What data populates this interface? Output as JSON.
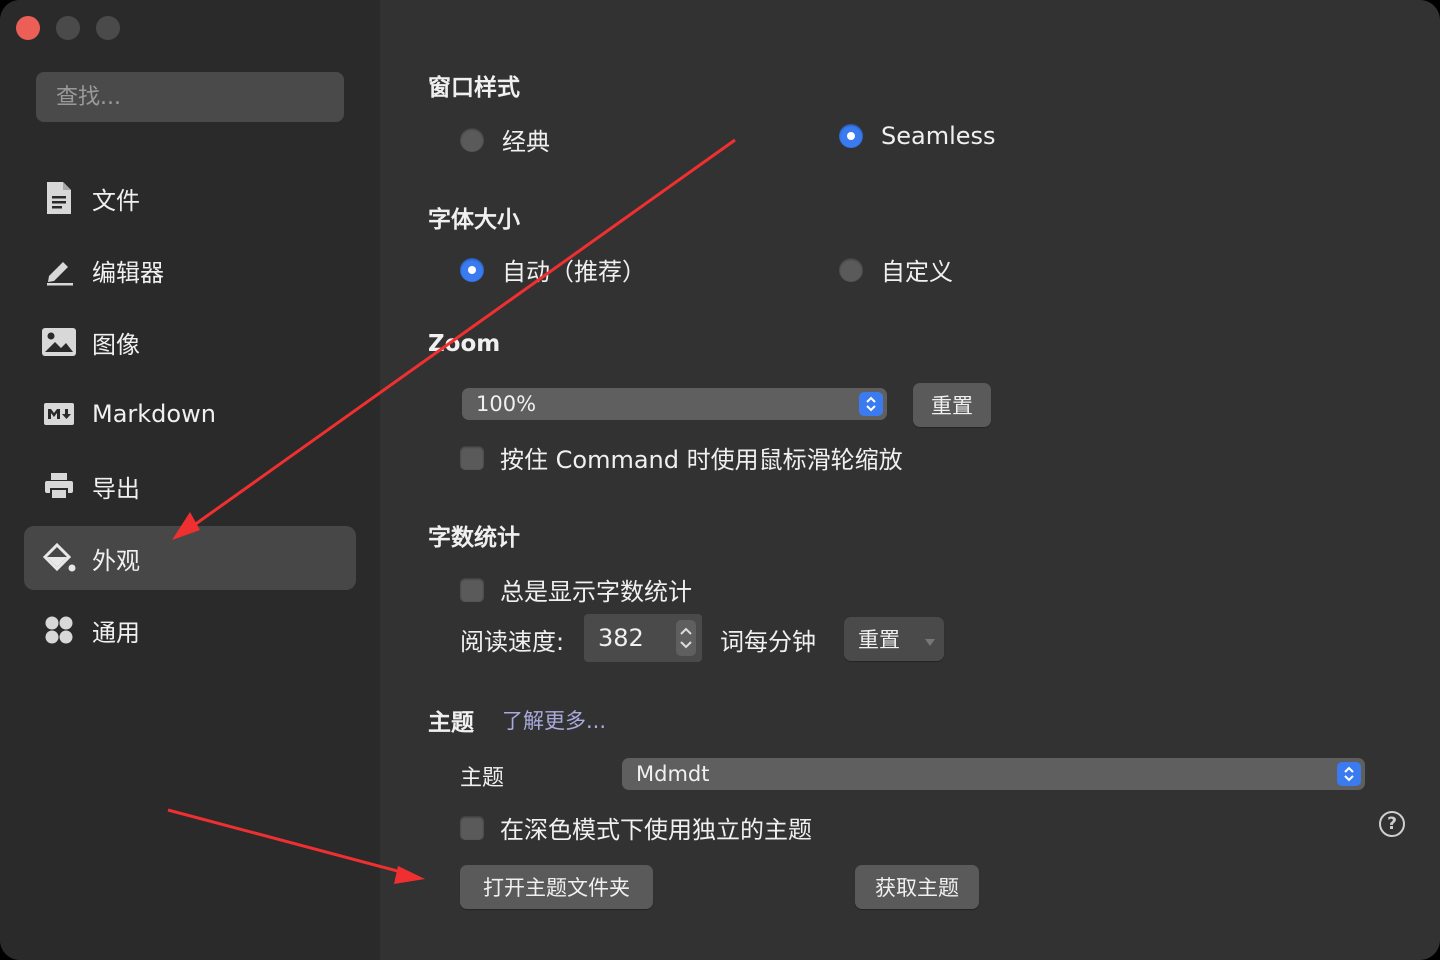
{
  "window": {
    "traffic_lights": [
      "close",
      "minimize",
      "maximize"
    ]
  },
  "sidebar": {
    "search_placeholder": "查找...",
    "items": [
      {
        "label": "文件",
        "icon": "file-icon"
      },
      {
        "label": "编辑器",
        "icon": "pencil-icon"
      },
      {
        "label": "图像",
        "icon": "image-icon"
      },
      {
        "label": "Markdown",
        "icon": "markdown-icon"
      },
      {
        "label": "导出",
        "icon": "printer-icon"
      },
      {
        "label": "外观",
        "icon": "paint-bucket-icon",
        "active": true
      },
      {
        "label": "通用",
        "icon": "grid-icon"
      }
    ]
  },
  "window_style": {
    "title": "窗口样式",
    "options": [
      "经典",
      "Seamless"
    ],
    "selected": "Seamless"
  },
  "font_size": {
    "title": "字体大小",
    "options": [
      "自动（推荐）",
      "自定义"
    ],
    "selected": "自动（推荐）"
  },
  "zoom": {
    "title": "Zoom",
    "value": "100%",
    "reset_label": "重置",
    "command_scroll_label": "按住 Command 时使用鼠标滑轮缩放"
  },
  "word_count": {
    "title": "字数统计",
    "always_show_label": "总是显示字数统计",
    "reading_speed_label": "阅读速度:",
    "reading_speed_value": "382",
    "unit_label": "词每分钟",
    "reset_label": "重置"
  },
  "theme": {
    "title": "主题",
    "learn_more": "了解更多...",
    "theme_label": "主题",
    "theme_value": "Mdmdt",
    "dark_mode_label": "在深色模式下使用独立的主题",
    "open_folder_label": "打开主题文件夹",
    "get_themes_label": "获取主题"
  },
  "colors": {
    "accent": "#3a7bf0",
    "annotation_arrow": "#f03030"
  }
}
